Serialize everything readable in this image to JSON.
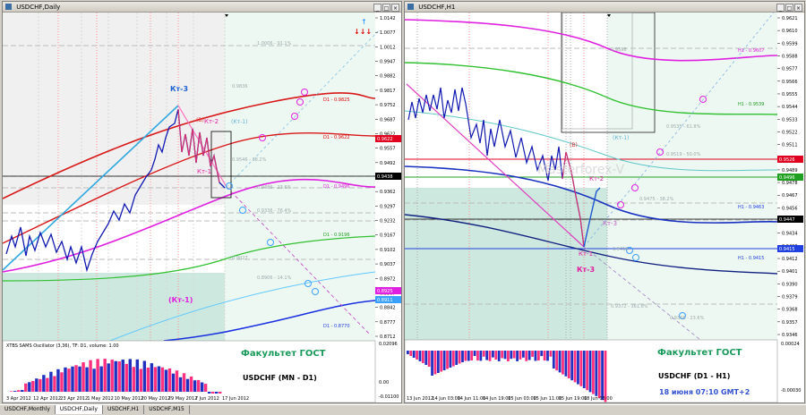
{
  "left": {
    "title": "USDCHF,Daily",
    "overlay_title": "Факультет ГОСТ",
    "overlay_pair": "USDCHF (MN - D1)",
    "osc_label": "XTBS SAMS Oscillator (3,36), TF: D1, volume: 1.00",
    "labels": {
      "kt3": "Кт-3",
      "kt2": "Кт-2",
      "kt1": "Кт-1",
      "kt1b": "(Кт-1)",
      "kt1c": "(Кт-1)",
      "b": "(В)"
    },
    "xticks": [
      "3 Apr 2012",
      "12 Apr 2012",
      "23 Apr 2012",
      "1 May 2012",
      "10 May 2012",
      "20 May 2012",
      "29 May 2012",
      "7 Jun 2012",
      "17 Jun 2012"
    ],
    "yticks": [
      "1.0142",
      "1.0077",
      "1.0012",
      "0.9947",
      "0.9882",
      "0.9817",
      "0.9752",
      "0.9687",
      "0.9622",
      "0.9557",
      "0.9492",
      "0.9427",
      "0.9362",
      "0.9297",
      "0.9232",
      "0.9167",
      "0.9102",
      "0.9037",
      "0.8972",
      "0.8907",
      "0.8842",
      "0.8777",
      "0.8712"
    ],
    "price_tags": [
      {
        "value": "0.9622",
        "color": "#e0001f"
      },
      {
        "value": "0.9438",
        "color": "#000000"
      },
      {
        "value": "0.8925",
        "color": "#e020e0"
      },
      {
        "value": "0.8911",
        "color": "#3aa0ff"
      }
    ],
    "hline_labels": [
      {
        "text": "D1 - 0.9825",
        "color": "#e00000"
      },
      {
        "text": "D1 - 0.9622",
        "color": "#e00000"
      },
      {
        "text": "D1 - 0.9496",
        "color": "#e020e0"
      },
      {
        "text": "D1 - 0.9196",
        "color": "#20a020"
      },
      {
        "text": "D1 - 0.8770",
        "color": "#2040e0"
      }
    ],
    "fib_labels": [
      "1.0006 - 91.1%",
      "0.9836",
      "0.9546 - 38.2%",
      "0.9486 - 23.6%",
      "0.9336 - 76.4%",
      "0.9027",
      "0.8906 - 14.1%"
    ],
    "osc_yticks": [
      "0.02096",
      "0.00",
      "-0.01100"
    ]
  },
  "right": {
    "title": "USDCHF,H1",
    "overlay_title": "Факультет ГОСТ",
    "overlay_pair": "USDCHF (D1 - H1)",
    "overlay_date": "18 июня 07:10 GMT+2",
    "watermark": "Masterforex-V",
    "labels": {
      "kt3": "Кт-3",
      "kt2": "Кт-2",
      "kt1": "Кт-1",
      "kt1b": "(Кт-1)",
      "kt3b": "Кт-3",
      "b": "(В)"
    },
    "xticks": [
      "13 Jun 2012",
      "14 Jun 03:00",
      "14 Jun 11:00",
      "14 Jun 19:00",
      "15 Jun 03:00",
      "15 Jun 11:00",
      "15 Jun 19:00",
      "18 Jun 03:00"
    ],
    "yticks": [
      "0.9621",
      "0.9610",
      "0.9599",
      "0.9588",
      "0.9577",
      "0.9566",
      "0.9555",
      "0.9544",
      "0.9533",
      "0.9522",
      "0.9511",
      "0.9500",
      "0.9489",
      "0.9478",
      "0.9467",
      "0.9456",
      "0.9445",
      "0.9434",
      "0.9423",
      "0.9412",
      "0.9401",
      "0.9390",
      "0.9379",
      "0.9368",
      "0.9357",
      "0.9346"
    ],
    "price_tags": [
      {
        "value": "0.9526",
        "color": "#e0001f"
      },
      {
        "value": "0.9496",
        "color": "#20a020"
      },
      {
        "value": "0.9447",
        "color": "#000000"
      },
      {
        "value": "0.9415",
        "color": "#2040e0"
      }
    ],
    "hline_labels": [
      {
        "text": "H1 - 0.9607",
        "color": "#e020e0"
      },
      {
        "text": "H1 - 0.9539",
        "color": "#20a020"
      },
      {
        "text": "H1 - 0.9463",
        "color": "#2040e0"
      },
      {
        "text": "H1 - 0.9415",
        "color": "#2040e0"
      }
    ],
    "fib_labels": [
      "0.9598",
      "0.9535 - 61.8%",
      "0.9519 - 50.0%",
      "0.9475 - 38.2%",
      "0.9418",
      "0.9372 - 361.8%",
      "0.9366 - 23.6%"
    ],
    "osc_yticks": [
      "0.00024",
      "-0.00030"
    ]
  },
  "tabs": [
    "USDCHF,Monthly",
    "USDCHF,Daily",
    "USDCHF,H1",
    "USDCHF,M15"
  ],
  "active_tab": 1,
  "signal": {
    "up": "↑",
    "down": "↓↓↓"
  }
}
